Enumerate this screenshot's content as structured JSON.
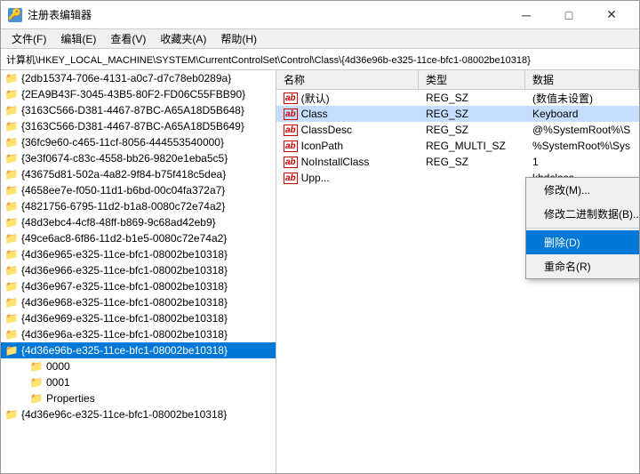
{
  "window": {
    "title": "注册表编辑器",
    "title_icon": "🔑",
    "min_label": "─",
    "max_label": "□",
    "close_label": "✕"
  },
  "menu": {
    "items": [
      "文件(F)",
      "编辑(E)",
      "查看(V)",
      "收藏夹(A)",
      "帮助(H)"
    ]
  },
  "address": {
    "label": "计算机\\HKEY_LOCAL_MACHINE\\SYSTEM\\CurrentControlSet\\Control\\Class\\{4d36e96b-e325-11ce-bfc1-08002be10318}"
  },
  "left_panel": {
    "items": [
      {
        "id": "item1",
        "label": "{2db15374-706e-4131-a0c7-d7c78eb0289a}",
        "indent": 0,
        "selected": false
      },
      {
        "id": "item2",
        "label": "{2EA9B43F-3045-43B5-80F2-FD06C55FBB90}",
        "indent": 0,
        "selected": false
      },
      {
        "id": "item3",
        "label": "{3163C566-D381-4467-87BC-A65A18D5B648}",
        "indent": 0,
        "selected": false
      },
      {
        "id": "item4",
        "label": "{3163C566-D381-4467-87BC-A65A18D5B649}",
        "indent": 0,
        "selected": false
      },
      {
        "id": "item5",
        "label": "{36fc9e60-c465-11cf-8056-444553540000}",
        "indent": 0,
        "selected": false
      },
      {
        "id": "item6",
        "label": "{3e3f0674-c83c-4558-bb26-9820e1eba5c5}",
        "indent": 0,
        "selected": false
      },
      {
        "id": "item7",
        "label": "{43675d81-502a-4a82-9f84-b75f418c5dea}",
        "indent": 0,
        "selected": false
      },
      {
        "id": "item8",
        "label": "{4658ee7e-f050-11d1-b6bd-00c04fa372a7}",
        "indent": 0,
        "selected": false
      },
      {
        "id": "item9",
        "label": "{4821756-6795-11d2-b1a8-0080c72e74a2}",
        "indent": 0,
        "selected": false
      },
      {
        "id": "item10",
        "label": "{48d3ebc4-4cf8-48ff-b869-9c68ad42eb9}",
        "indent": 0,
        "selected": false
      },
      {
        "id": "item11",
        "label": "{49ce6ac8-6f86-11d2-b1e5-0080c72e74a2}",
        "indent": 0,
        "selected": false
      },
      {
        "id": "item12",
        "label": "{4d36e965-e325-11ce-bfc1-08002be10318}",
        "indent": 0,
        "selected": false
      },
      {
        "id": "item13",
        "label": "{4d36e966-e325-11ce-bfc1-08002be10318}",
        "indent": 0,
        "selected": false
      },
      {
        "id": "item14",
        "label": "{4d36e967-e325-11ce-bfc1-08002be10318}",
        "indent": 0,
        "selected": false
      },
      {
        "id": "item15",
        "label": "{4d36e968-e325-11ce-bfc1-08002be10318}",
        "indent": 0,
        "selected": false
      },
      {
        "id": "item16",
        "label": "{4d36e969-e325-11ce-bfc1-08002be10318}",
        "indent": 0,
        "selected": false
      },
      {
        "id": "item17",
        "label": "{4d36e96a-e325-11ce-bfc1-08002be10318}",
        "indent": 0,
        "selected": false
      },
      {
        "id": "item18",
        "label": "{4d36e96b-e325-11ce-bfc1-08002be10318}",
        "indent": 0,
        "selected": true
      },
      {
        "id": "item19",
        "label": "0000",
        "indent": 1,
        "selected": false
      },
      {
        "id": "item20",
        "label": "0001",
        "indent": 1,
        "selected": false
      },
      {
        "id": "item21",
        "label": "Properties",
        "indent": 1,
        "selected": false
      },
      {
        "id": "item22",
        "label": "{4d36e96c-e325-11ce-bfc1-08002be10318}",
        "indent": 0,
        "selected": false
      }
    ]
  },
  "right_panel": {
    "columns": [
      "名称",
      "类型",
      "数据"
    ],
    "rows": [
      {
        "name": "(默认)",
        "type": "REG_SZ",
        "data": "(数值未设置)",
        "icon": "ab"
      },
      {
        "name": "Class",
        "type": "REG_SZ",
        "data": "Keyboard",
        "icon": "ab",
        "highlighted": true
      },
      {
        "name": "ClassDesc",
        "type": "REG_SZ",
        "data": "@%SystemRoot%\\S",
        "icon": "ab"
      },
      {
        "name": "IconPath",
        "type": "REG_MULTI_SZ",
        "data": "%SystemRoot%\\Sys",
        "icon": "ab"
      },
      {
        "name": "NoInstallClass",
        "type": "REG_SZ",
        "data": "1",
        "icon": "ab"
      },
      {
        "name": "Upp...",
        "type": "",
        "data": "kbdclass",
        "icon": "ab"
      }
    ]
  },
  "context_menu": {
    "items": [
      {
        "id": "modify",
        "label": "修改(M)...",
        "active": false
      },
      {
        "id": "modify_bin",
        "label": "修改二进制数据(B)...",
        "active": false
      },
      {
        "id": "separator1",
        "type": "separator"
      },
      {
        "id": "delete",
        "label": "删除(D)",
        "active": true
      },
      {
        "id": "rename",
        "label": "重命名(R)",
        "active": false
      }
    ]
  }
}
